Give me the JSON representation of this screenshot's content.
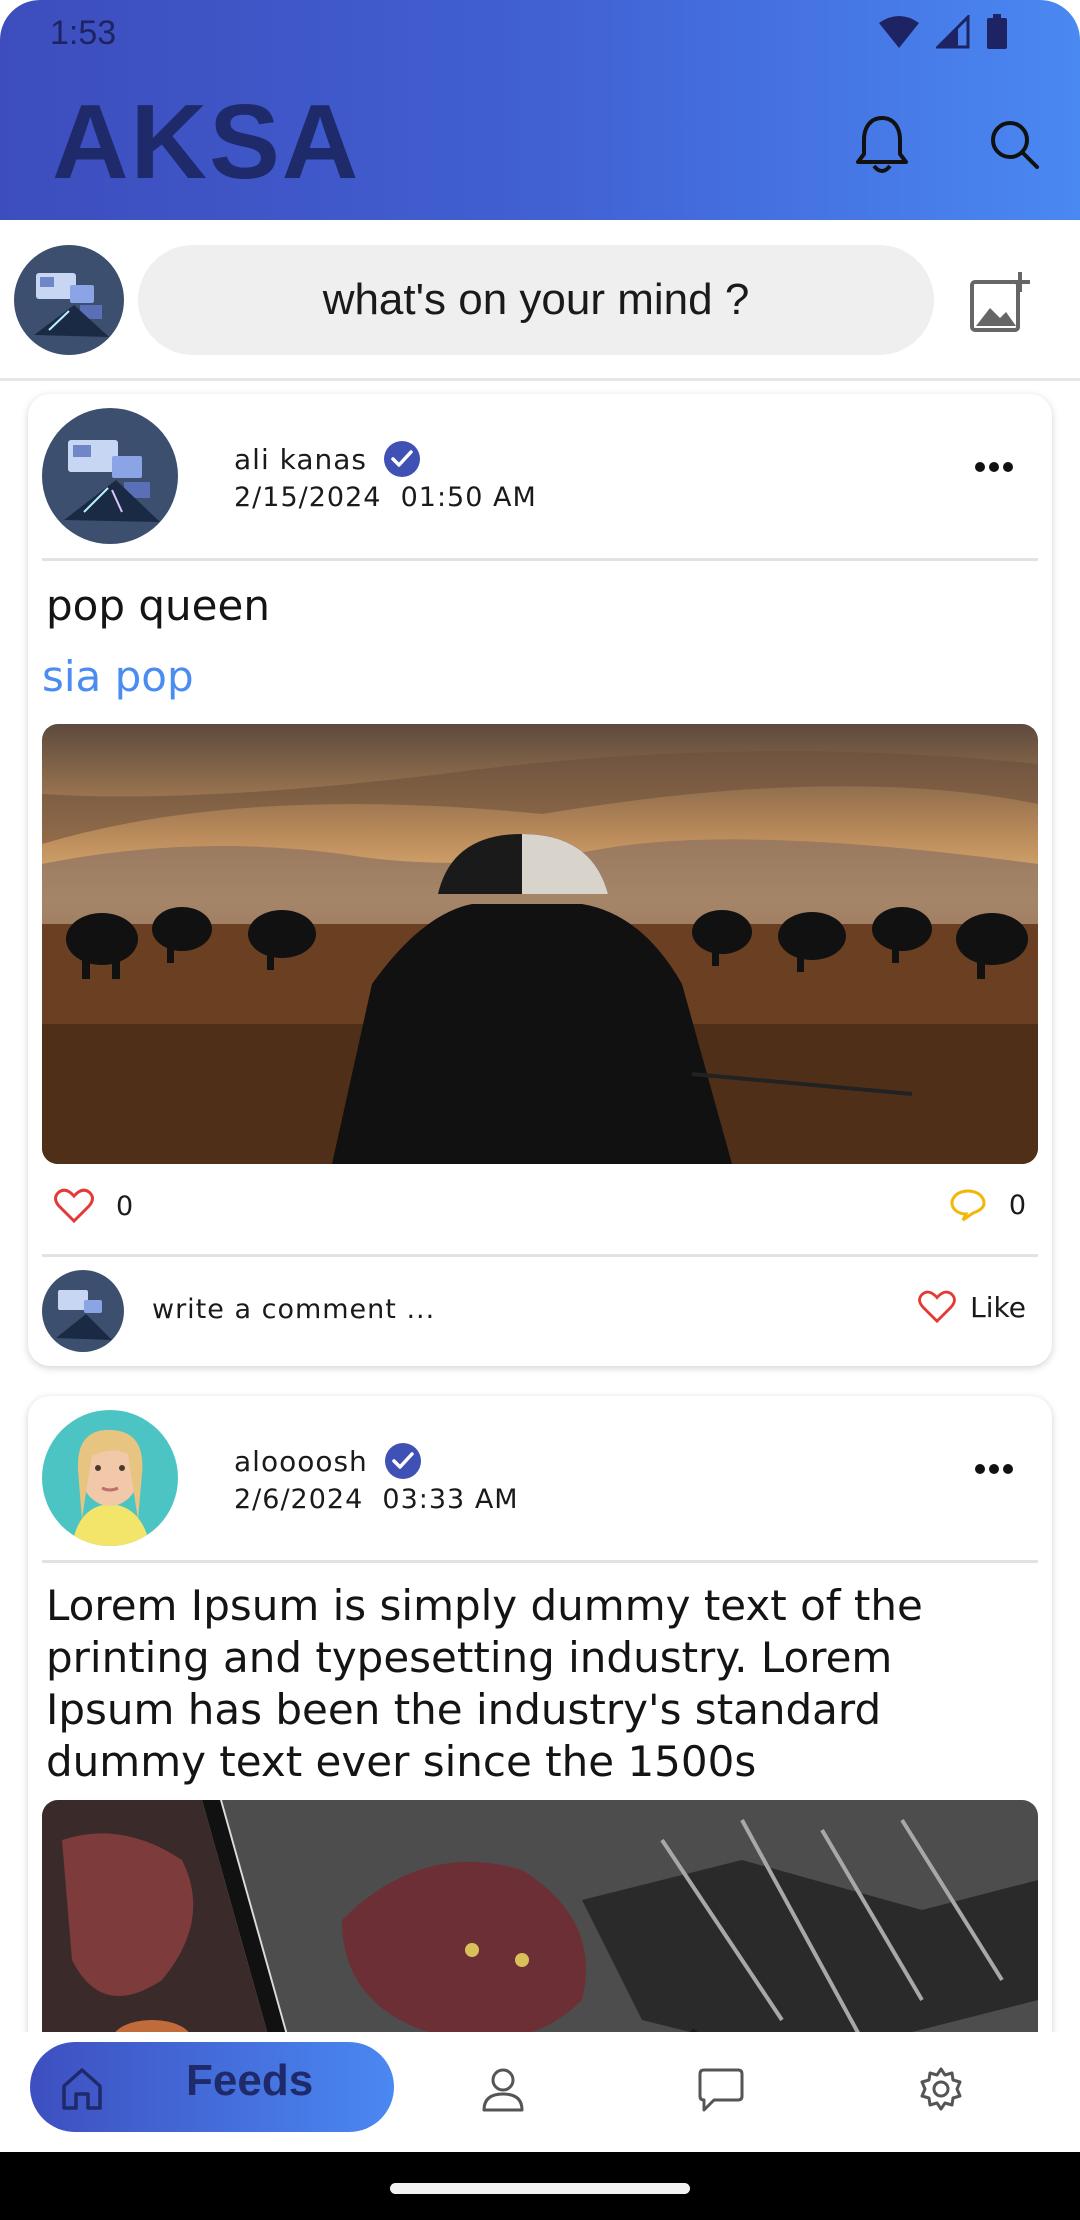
{
  "status_bar": {
    "time": "1:53"
  },
  "app_bar": {
    "title": "AKSA"
  },
  "composer": {
    "placeholder": "what's on your mind ?"
  },
  "posts": [
    {
      "author": "ali kanas",
      "date": "2/15/2024  01:50 AM",
      "text": "pop queen",
      "tag": "sia pop",
      "likes": "0",
      "comments": "0",
      "comment_placeholder": "write a comment ...",
      "like_label": "Like"
    },
    {
      "author": "aloooosh",
      "date": "2/6/2024  03:33 AM",
      "text": "Lorem Ipsum is simply dummy text of the printing and typesetting industry. Lorem Ipsum has been the industry's standard dummy text ever since the 1500s"
    }
  ],
  "bottom_nav": {
    "active_label": "Feeds",
    "items": [
      "home-icon",
      "profile-icon",
      "chat-icon",
      "settings-icon"
    ]
  },
  "colors": {
    "brand_start": "#3d4dbd",
    "brand_end": "#4a88f2",
    "title_text": "#1e2a6a",
    "link": "#4a8cf0",
    "like_red": "#e53935",
    "comment_yellow": "#f2b705",
    "verified_blue": "#3f51b5"
  }
}
